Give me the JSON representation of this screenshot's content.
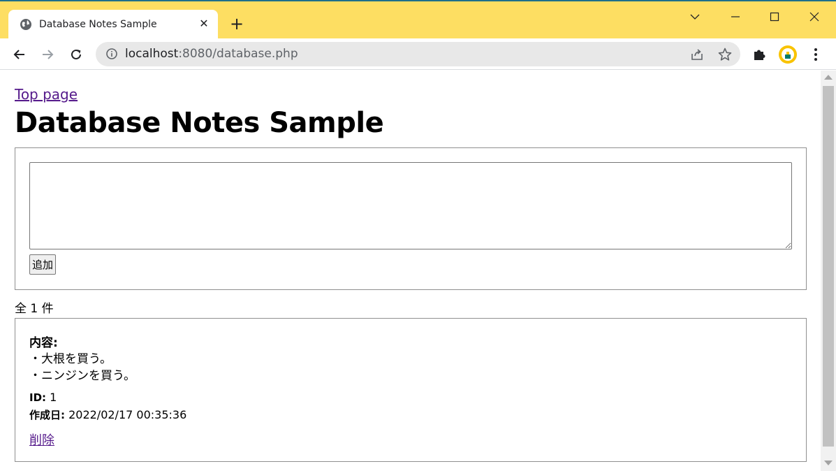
{
  "browser": {
    "tab_title": "Database Notes Sample",
    "tab_close": "✕",
    "new_tab": "+",
    "url_host": "localhost",
    "url_rest": ":8080/database.php",
    "accent_color": "#fdde62"
  },
  "page": {
    "top_link": "Top page",
    "title": "Database Notes Sample",
    "textarea_value": "",
    "add_button": "追加",
    "count_text": "全 1 件"
  },
  "note": {
    "content_label": "内容:",
    "lines": [
      "・大根を買う。",
      "・ニンジンを買う。"
    ],
    "id_label": "ID:",
    "id_value": " 1",
    "created_label": "作成日:",
    "created_value": " 2022/02/17 00:35:36",
    "delete_link": "削除"
  }
}
